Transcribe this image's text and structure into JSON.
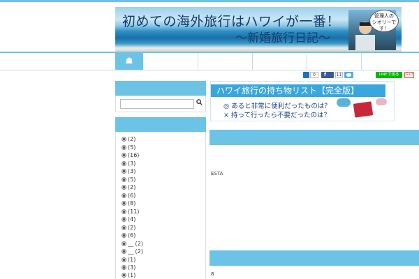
{
  "banner": {
    "title": "初めての海外旅行はハワイが一番！",
    "subtitle": "〜新婚旅行日記〜",
    "bubble_text": "管理人の\nシオリーです！",
    "photo_icon": "author-photo"
  },
  "nav": {
    "home_icon": "home-icon",
    "home_glyph": "☗",
    "items": [
      "",
      "",
      "",
      "",
      ""
    ]
  },
  "social": {
    "hatena_count": "0",
    "facebook_count": "11",
    "line_label": "LINEで送る",
    "gplus_label": "G+1",
    "colors": {
      "hatena": "#1d74b8",
      "facebook": "#3b5998",
      "twitter": "#55acee",
      "line": "#00b900",
      "gplus": "#dd4b39"
    }
  },
  "sidebar": {
    "search_icon_glyph": "🔍",
    "categories": [
      {
        "label": "(2)"
      },
      {
        "label": "(5)"
      },
      {
        "label": "(16)"
      },
      {
        "label": "(3)"
      },
      {
        "label": "(3)"
      },
      {
        "label": "(5)"
      },
      {
        "label": "(2)"
      },
      {
        "label": "(6)"
      },
      {
        "label": "(8)"
      },
      {
        "label": "(11)"
      },
      {
        "label": "(4)"
      },
      {
        "label": "(2)"
      },
      {
        "label": "(6)"
      },
      {
        "label": "__ (2)"
      },
      {
        "label": "__ (2)"
      },
      {
        "label": "(1)"
      },
      {
        "label": "(3)"
      },
      {
        "label": "(1)"
      }
    ]
  },
  "ad": {
    "title": "ハワイ旅行の持ち物リスト【完全版】",
    "line1": "◎ あると非常に便利だったものは？",
    "line2": "× 持って行ったら不要だったのは？"
  },
  "main": {
    "section1_text": "ESTA",
    "section2_text": "8"
  },
  "colors": {
    "accent": "#6cc3e6",
    "banner_text": "#143a6e"
  }
}
